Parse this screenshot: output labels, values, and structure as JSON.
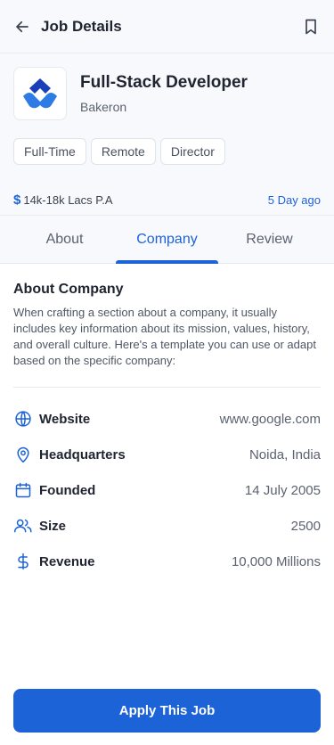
{
  "header": {
    "title": "Job Details",
    "back_icon": "arrow-left-icon",
    "bookmark_icon": "bookmark-icon"
  },
  "job": {
    "title": "Full-Stack Developer",
    "company": "Bakeron",
    "tags": [
      "Full-Time",
      "Remote",
      "Director"
    ],
    "salary_symbol": "$",
    "salary": "14k-18k Lacs P.A",
    "posted": "5 Day ago"
  },
  "tabs": [
    {
      "label": "About",
      "active": false
    },
    {
      "label": "Company",
      "active": true
    },
    {
      "label": "Review",
      "active": false
    }
  ],
  "about_company": {
    "title": "About Company",
    "description": "When crafting a section about a company, it usually includes key information about its mission, values, history, and overall culture. Here's a template you can use or adapt based on the specific company:"
  },
  "details": [
    {
      "icon": "globe-icon",
      "label": "Website",
      "value": "www.google.com"
    },
    {
      "icon": "location-pin-icon",
      "label": "Headquarters",
      "value": "Noida, India"
    },
    {
      "icon": "calendar-icon",
      "label": "Founded",
      "value": "14 July 2005"
    },
    {
      "icon": "users-icon",
      "label": "Size",
      "value": "2500"
    },
    {
      "icon": "dollar-icon",
      "label": "Revenue",
      "value": "10,000 Millions"
    }
  ],
  "apply_label": "Apply This Job",
  "colors": {
    "accent": "#1d63d8",
    "background_top": "#f7f9fc"
  }
}
